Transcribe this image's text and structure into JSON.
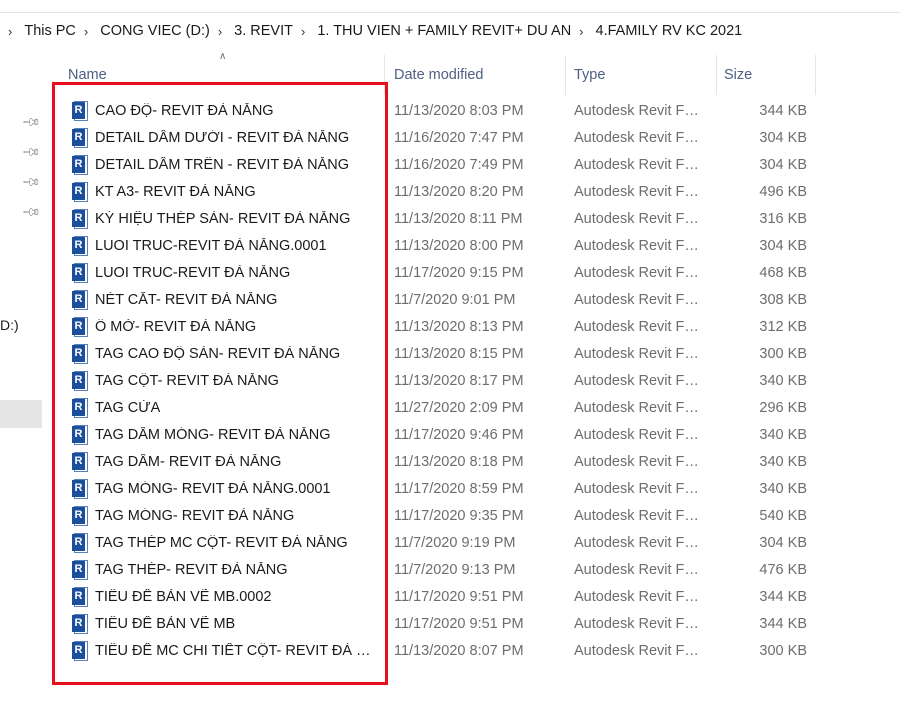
{
  "breadcrumb": {
    "items": [
      "This PC",
      "CONG VIEC (D:)",
      "3. REVIT",
      "1. THU VIEN + FAMILY REVIT+ DU AN",
      "4.FAMILY RV KC 2021"
    ]
  },
  "nav": {
    "drive_fragment": "D:)"
  },
  "columns": {
    "name": "Name",
    "date": "Date modified",
    "type": "Type",
    "size": "Size"
  },
  "files": [
    {
      "name": "CAO ĐỘ- REVIT ĐÀ NẴNG",
      "date": "11/13/2020 8:03 PM",
      "type": "Autodesk Revit Fa...",
      "size": "344 KB"
    },
    {
      "name": "DETAIL DẦM DƯỚI - REVIT ĐÀ NẴNG",
      "date": "11/16/2020 7:47 PM",
      "type": "Autodesk Revit Fa...",
      "size": "304 KB"
    },
    {
      "name": "DETAIL DẦM TRÊN - REVIT ĐÀ NẴNG",
      "date": "11/16/2020 7:49 PM",
      "type": "Autodesk Revit Fa...",
      "size": "304 KB"
    },
    {
      "name": "KT A3- REVIT ĐÀ NẴNG",
      "date": "11/13/2020 8:20 PM",
      "type": "Autodesk Revit Fa...",
      "size": "496 KB"
    },
    {
      "name": "KÝ HIỆU THÉP SÀN- REVIT ĐÀ NẴNG",
      "date": "11/13/2020 8:11 PM",
      "type": "Autodesk Revit Fa...",
      "size": "316 KB"
    },
    {
      "name": "LUOI TRUC-REVIT ĐÀ NẴNG.0001",
      "date": "11/13/2020 8:00 PM",
      "type": "Autodesk Revit Fa...",
      "size": "304 KB"
    },
    {
      "name": "LUOI TRUC-REVIT ĐÀ NẴNG",
      "date": "11/17/2020 9:15 PM",
      "type": "Autodesk Revit Fa...",
      "size": "468 KB"
    },
    {
      "name": "NÉT CẮT- REVIT ĐÀ NẴNG",
      "date": "11/7/2020 9:01 PM",
      "type": "Autodesk Revit Fa...",
      "size": "308 KB"
    },
    {
      "name": "Ô MỞ- REVIT ĐÀ NẴNG",
      "date": "11/13/2020 8:13 PM",
      "type": "Autodesk Revit Fa...",
      "size": "312 KB"
    },
    {
      "name": "TAG CAO ĐỘ SÀN- REVIT ĐÀ NẴNG",
      "date": "11/13/2020 8:15 PM",
      "type": "Autodesk Revit Fa...",
      "size": "300 KB"
    },
    {
      "name": "TAG CỘT- REVIT ĐÀ NẴNG",
      "date": "11/13/2020 8:17 PM",
      "type": "Autodesk Revit Fa...",
      "size": "340 KB"
    },
    {
      "name": "TAG CỬA",
      "date": "11/27/2020 2:09 PM",
      "type": "Autodesk Revit Fa...",
      "size": "296 KB"
    },
    {
      "name": "TAG DẦM MÓNG- REVIT ĐÀ NẴNG",
      "date": "11/17/2020 9:46 PM",
      "type": "Autodesk Revit Fa...",
      "size": "340 KB"
    },
    {
      "name": "TAG DẦM- REVIT ĐÀ NẴNG",
      "date": "11/13/2020 8:18 PM",
      "type": "Autodesk Revit Fa...",
      "size": "340 KB"
    },
    {
      "name": "TAG MÓNG- REVIT ĐÀ NẴNG.0001",
      "date": "11/17/2020 8:59 PM",
      "type": "Autodesk Revit Fa...",
      "size": "340 KB"
    },
    {
      "name": "TAG MÓNG- REVIT ĐÀ NẴNG",
      "date": "11/17/2020 9:35 PM",
      "type": "Autodesk Revit Fa...",
      "size": "540 KB"
    },
    {
      "name": "TAG THÉP MC CỘT- REVIT ĐÀ NẴNG",
      "date": "11/7/2020 9:19 PM",
      "type": "Autodesk Revit Fa...",
      "size": "304 KB"
    },
    {
      "name": "TAG THÉP- REVIT ĐÀ NẴNG",
      "date": "11/7/2020 9:13 PM",
      "type": "Autodesk Revit Fa...",
      "size": "476 KB"
    },
    {
      "name": "TIÊU ĐỀ BẢN VẼ MB.0002",
      "date": "11/17/2020 9:51 PM",
      "type": "Autodesk Revit Fa...",
      "size": "344 KB"
    },
    {
      "name": "TIÊU ĐỀ BẢN VẼ MB",
      "date": "11/17/2020 9:51 PM",
      "type": "Autodesk Revit Fa...",
      "size": "344 KB"
    },
    {
      "name": "TIÊU ĐỀ MC CHI TIẾT CỘT- REVIT ĐÀ NẴNG",
      "date": "11/13/2020 8:07 PM",
      "type": "Autodesk Revit Fa...",
      "size": "300 KB"
    }
  ],
  "icons": {
    "file_icon": "revit-family-file-icon",
    "badge_letter": "R",
    "pin_icon": "pin-icon",
    "sort_icon": "sort-ascending-icon"
  },
  "colors": {
    "highlight": "#e8101c",
    "header_text": "#4d6082",
    "revit_blue": "#1b4f9c"
  }
}
